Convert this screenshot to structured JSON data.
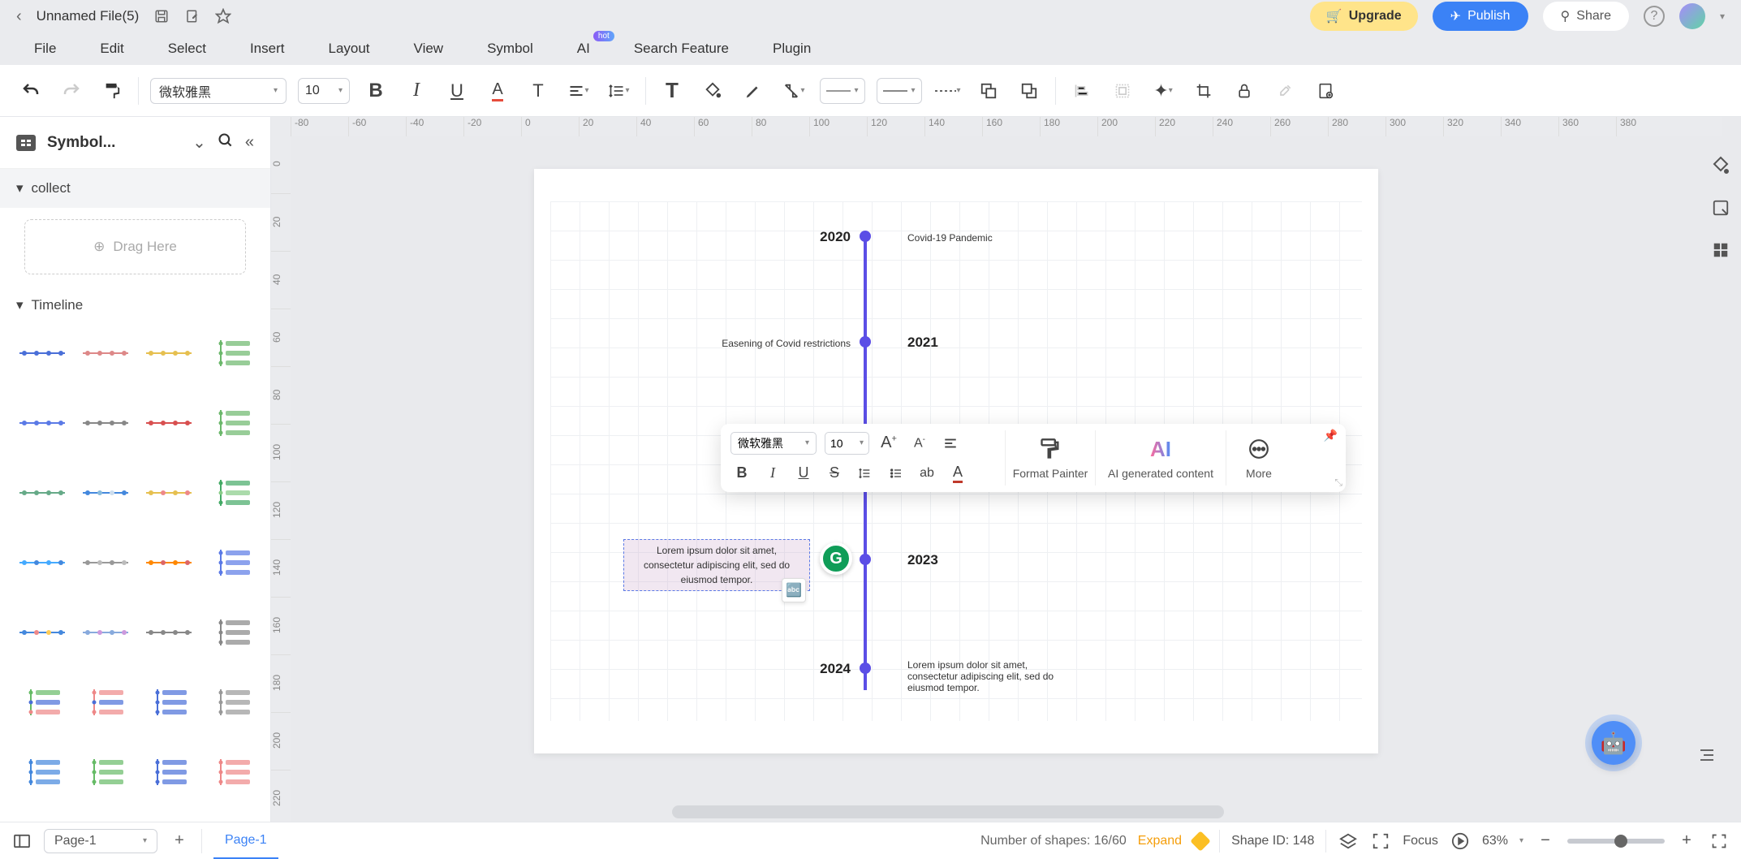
{
  "titlebar": {
    "filename": "Unnamed File(5)",
    "upgrade": "Upgrade",
    "publish": "Publish",
    "share": "Share"
  },
  "menus": [
    "File",
    "Edit",
    "Select",
    "Insert",
    "Layout",
    "View",
    "Symbol",
    "AI",
    "Search Feature",
    "Plugin"
  ],
  "menu_hot_index": 7,
  "hot_label": "hot",
  "toolbar": {
    "font": "微软雅黑",
    "size": "10"
  },
  "sidebar": {
    "title": "Symbol...",
    "collect_label": "collect",
    "drag_here": "Drag Here",
    "timeline_label": "Timeline"
  },
  "ruler_h": [
    "-80",
    "-60",
    "-40",
    "-20",
    "0",
    "20",
    "40",
    "60",
    "80",
    "100",
    "120",
    "140",
    "160",
    "180",
    "200",
    "220",
    "240",
    "260",
    "280",
    "300",
    "320",
    "340",
    "360",
    "380"
  ],
  "ruler_v": [
    "0",
    "20",
    "40",
    "60",
    "80",
    "100",
    "120",
    "140",
    "160",
    "180",
    "200",
    "220"
  ],
  "timeline": {
    "events": [
      {
        "year": "2020",
        "side": "left",
        "label": "Covid-19 Pandemic",
        "label_side": "right"
      },
      {
        "year": "2021",
        "side": "right",
        "label": "Easening of Covid restrictions",
        "label_side": "left"
      },
      {
        "year": "2023",
        "side": "right",
        "label": "Lorem ipsum dolor sit amet, consectetur adipiscing elit, sed do eiusmod tempor.",
        "label_side": "left",
        "selected": true
      },
      {
        "year": "2024",
        "side": "left",
        "label": "Lorem ipsum dolor sit amet, consectetur adipiscing elit, sed do eiusmod tempor.",
        "label_side": "right"
      }
    ]
  },
  "ctx_toolbar": {
    "font": "微软雅黑",
    "size": "10",
    "format_painter": "Format Painter",
    "ai_content": "AI generated content",
    "more": "More"
  },
  "statusbar": {
    "page_selector": "Page-1",
    "active_page": "Page-1",
    "shapes_label": "Number of shapes: 16/60",
    "expand": "Expand",
    "shape_id": "Shape ID: 148",
    "focus": "Focus",
    "zoom": "63%"
  }
}
